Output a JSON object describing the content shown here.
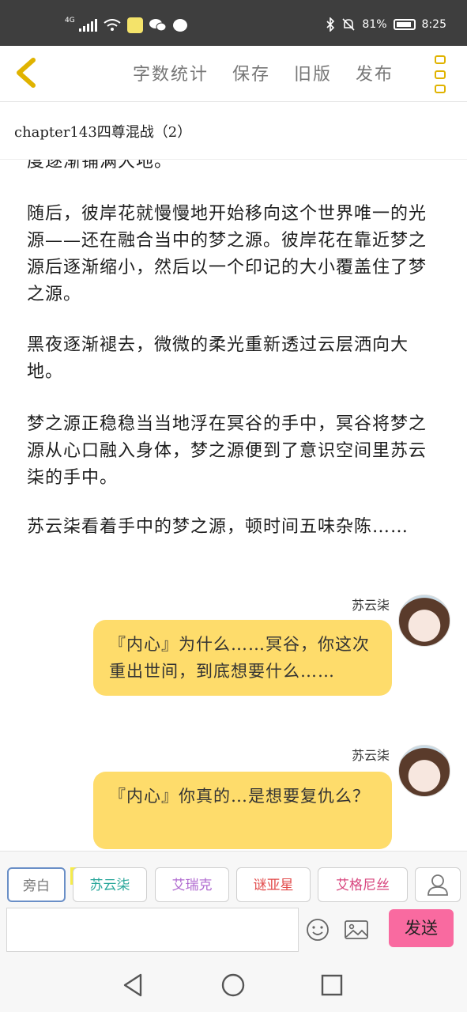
{
  "status_bar": {
    "network": "4G",
    "battery": "81%",
    "time": "8:25"
  },
  "header": {
    "actions": [
      "字数统计",
      "保存",
      "旧版",
      "发布"
    ]
  },
  "chapter": {
    "title": "chapter143四尊混战（2）"
  },
  "content": {
    "cut_line": "度逐渐铺满大地。",
    "paragraphs": [
      "随后，彼岸花就慢慢地开始移向这个世界唯一的光源——还在融合当中的梦之源。彼岸花在靠近梦之源后逐渐缩小，然后以一个印记的大小覆盖住了梦之源。",
      "黑夜逐渐褪去，微微的柔光重新透过云层洒向大地。",
      "梦之源正稳稳当当地浮在冥谷的手中，冥谷将梦之源从心口融入身体，梦之源便到了意识空间里苏云柒的手中。",
      "苏云柒看着手中的梦之源，顿时间五味杂陈……"
    ],
    "messages": [
      {
        "speaker": "苏云柒",
        "text": "『内心』为什么……冥谷，你这次重出世间，到底想要什么……"
      },
      {
        "speaker": "苏云柒",
        "text": "『内心』你真的…是想要复仇么？"
      }
    ]
  },
  "characters": {
    "narration": "旁白",
    "main_badge": "主",
    "list": [
      {
        "name": "苏云柒",
        "color": "#2aa79b"
      },
      {
        "name": "艾瑞克",
        "color": "#b06ad0"
      },
      {
        "name": "谜亚星",
        "color": "#e24a4a"
      },
      {
        "name": "艾格尼丝",
        "color": "#d8457e"
      }
    ]
  },
  "input": {
    "value": "",
    "placeholder": "",
    "send_label": "发送"
  },
  "colors": {
    "accent": "#e0b300",
    "bubble": "#fedc6b",
    "send": "#f96aa0"
  }
}
